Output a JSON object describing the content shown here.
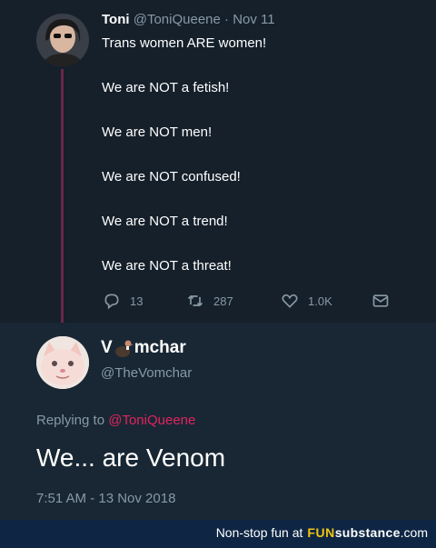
{
  "tweet1": {
    "name": "Toni",
    "handle": "@ToniQueene",
    "separator": "·",
    "date": "Nov 11",
    "lines": [
      "Trans women ARE women!",
      "",
      "We are NOT a fetish!",
      "",
      "We are NOT men!",
      "",
      "We are NOT confused!",
      "",
      "We are NOT a trend!",
      "",
      "We are NOT a threat!"
    ],
    "actions": {
      "reply_count": "13",
      "retweet_count": "287",
      "like_count": "1.0K"
    }
  },
  "tweet2": {
    "name_pre": "V",
    "name_post": "mchar",
    "handle": "@TheVomchar",
    "replying_to_label": "Replying to",
    "replying_to_handle": "@ToniQueene",
    "text": "We... are Venom",
    "timestamp": "7:51 AM - 13 Nov 2018"
  },
  "footer": {
    "text": "Non-stop fun at",
    "logo_fun": "FUN",
    "logo_sub": "substance",
    "logo_com": ".com"
  },
  "colors": {
    "background": "#15202b",
    "reply_background": "#192734",
    "secondary_text": "#8899a6",
    "mention": "#e0245e",
    "thread_line": "#6b2748",
    "footer_bg": "#0e2644",
    "logo_fun": "#f1c40f"
  },
  "icons": [
    "reply-icon",
    "retweet-icon",
    "like-icon",
    "message-icon",
    "vulture-emoji-icon"
  ]
}
